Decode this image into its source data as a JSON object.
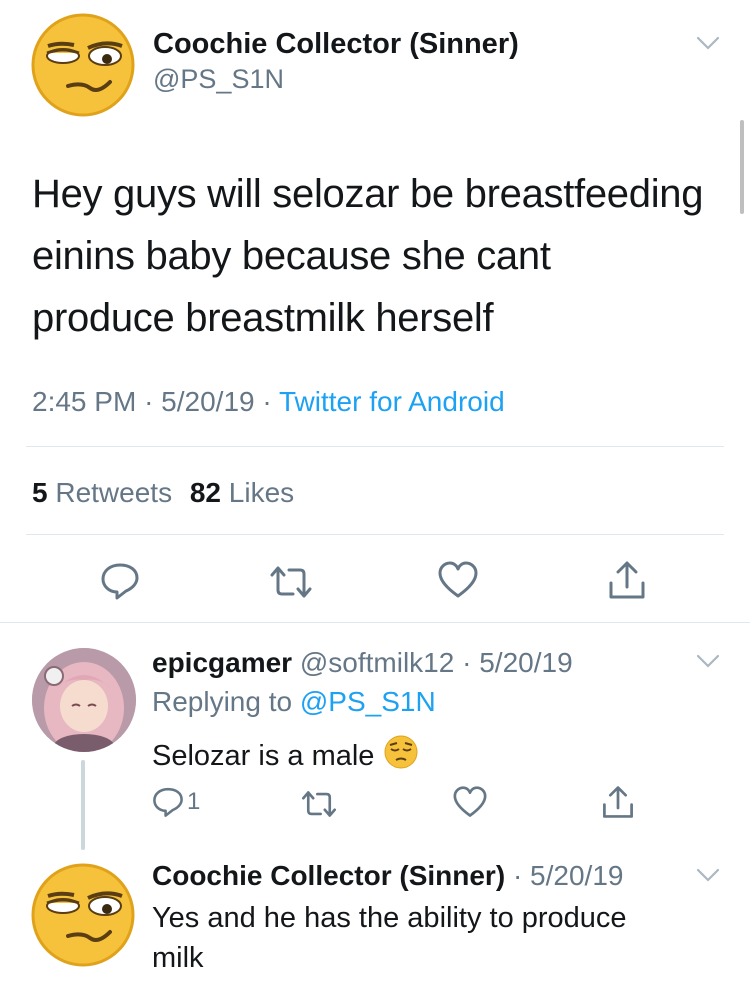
{
  "main_tweet": {
    "display_name": "Coochie Collector (Sinner)",
    "handle": "@PS_S1N",
    "text_lines": [
      "Hey guys will selozar be breastfeeding",
      "einins baby because she cant",
      "produce breastmilk herself"
    ],
    "time": "2:45 PM",
    "date": "5/20/19",
    "separator": "·",
    "source": "Twitter for Android",
    "retweet_count": "5",
    "retweet_label": "Retweets",
    "like_count": "82",
    "like_label": "Likes",
    "icons": {
      "avatar": "smirk-face-emoji-avatar",
      "menu": "chevron-down-icon",
      "reply": "reply-icon",
      "retweet": "retweet-icon",
      "like": "heart-icon",
      "share": "share-icon"
    }
  },
  "reply_1": {
    "display_name": "epicgamer",
    "handle": "@softmilk12",
    "date_sep": "·",
    "date": "5/20/19",
    "replying_label": "Replying to",
    "replying_handle": "@PS_S1N",
    "text": "Selozar is a male",
    "reply_count": "1",
    "icons": {
      "emoji": "pensive-face-emoji",
      "avatar": "anime-girl-avatar"
    }
  },
  "reply_2": {
    "display_name": "Coochie Collector (Sinner)",
    "date_sep": "·",
    "date": "5/20/19",
    "text_lines": [
      "Yes and he has the ability to produce",
      "milk"
    ]
  },
  "colors": {
    "text": "#14171a",
    "secondary": "#657786",
    "link": "#1da1f2",
    "divider": "#e1e8ed",
    "emoji_yellow": "#f7c23b"
  }
}
